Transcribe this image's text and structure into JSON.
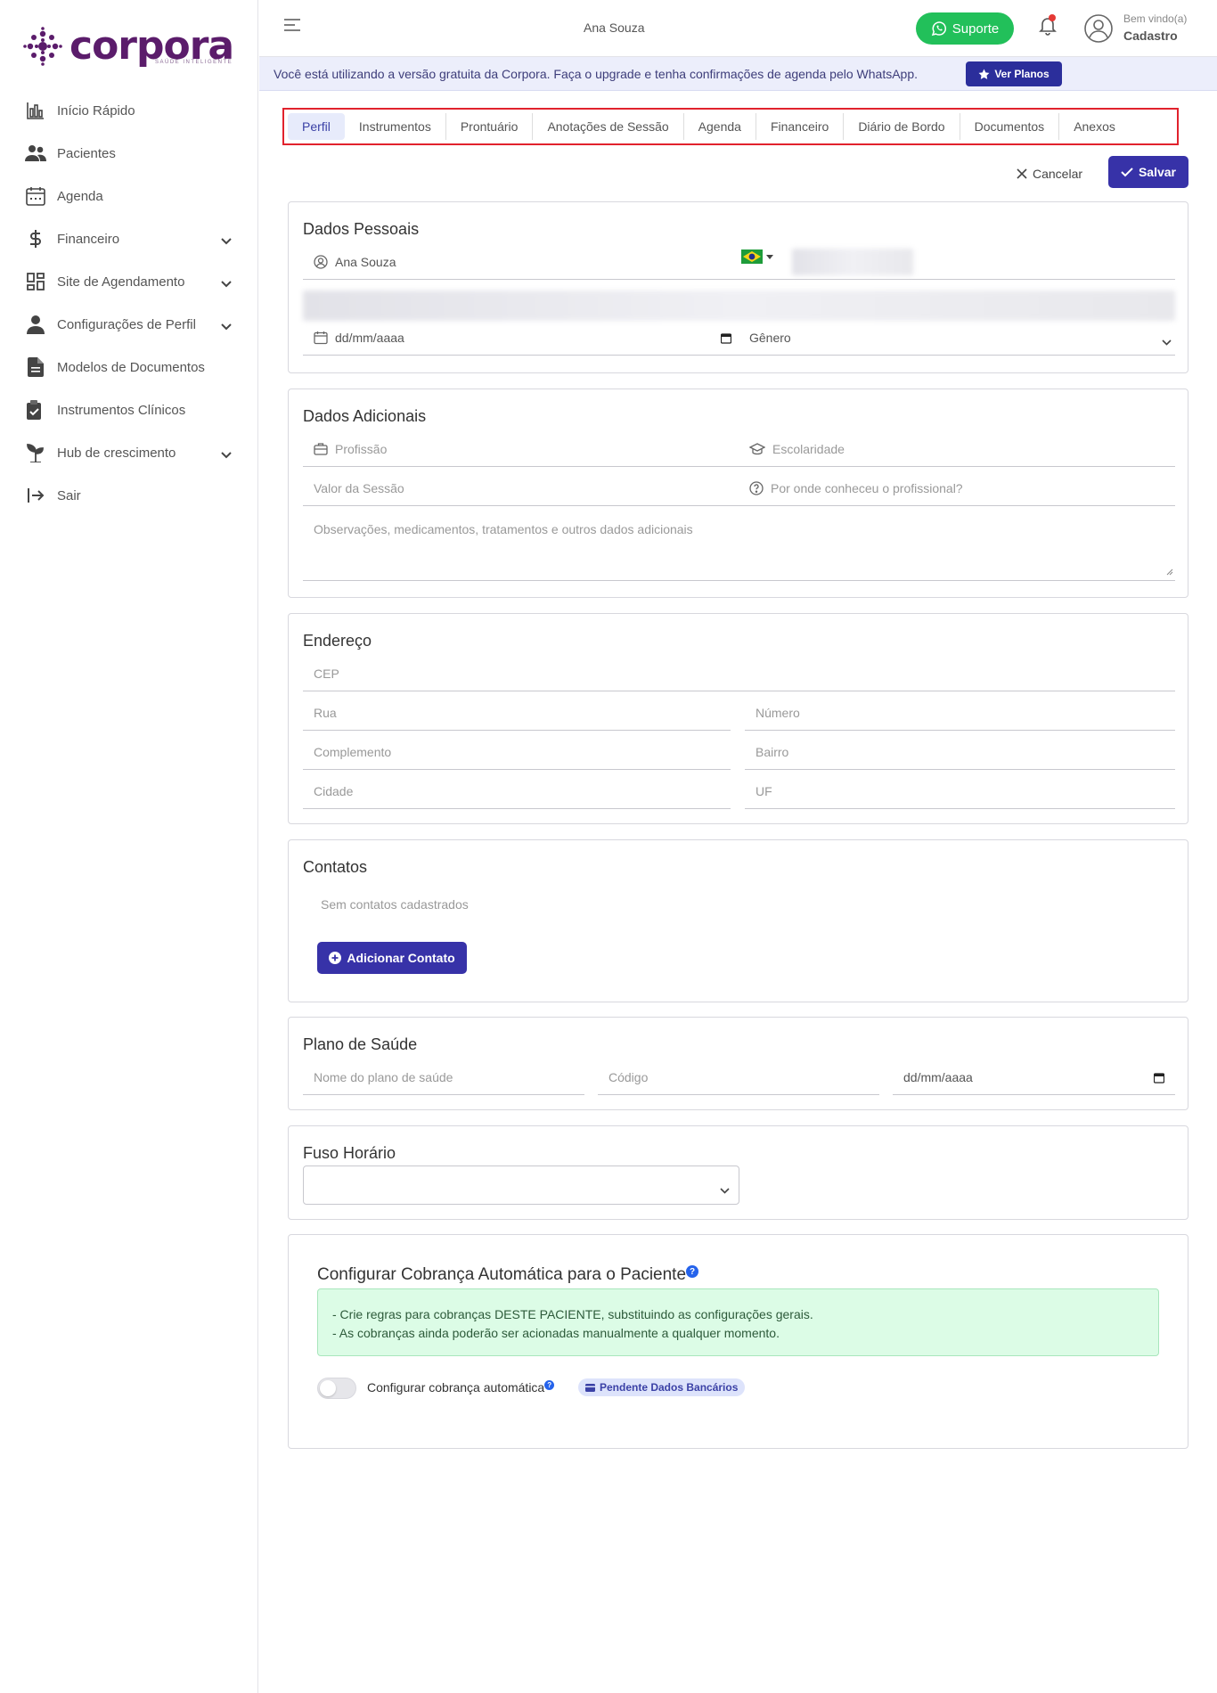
{
  "brand": {
    "name": "corpora",
    "tagline": "SAÚDE INTELIGENTE"
  },
  "sidebar": {
    "items": [
      {
        "label": "Início Rápido",
        "icon": "chart-bar-icon"
      },
      {
        "label": "Pacientes",
        "icon": "users-icon"
      },
      {
        "label": "Agenda",
        "icon": "calendar-icon"
      },
      {
        "label": "Financeiro",
        "icon": "dollar-icon",
        "expandable": true
      },
      {
        "label": "Site de Agendamento",
        "icon": "dashboard-icon",
        "expandable": true
      },
      {
        "label": "Configurações de Perfil",
        "icon": "user-icon",
        "expandable": true
      },
      {
        "label": "Modelos de Documentos",
        "icon": "document-icon"
      },
      {
        "label": "Instrumentos Clínicos",
        "icon": "clipboard-check-icon"
      },
      {
        "label": "Hub de crescimento",
        "icon": "sprout-icon",
        "expandable": true
      },
      {
        "label": "Sair",
        "icon": "logout-icon"
      }
    ]
  },
  "header": {
    "patient_name": "Ana Souza",
    "support_label": "Suporte",
    "welcome": "Bem vindo(a)",
    "user_name": "Cadastro"
  },
  "banner": {
    "text": "Você está utilizando a versão gratuita da Corpora. Faça o upgrade e tenha confirmações de agenda pelo WhatsApp.",
    "button": "Ver Planos"
  },
  "tabs": [
    "Perfil",
    "Instrumentos",
    "Prontuário",
    "Anotações de Sessão",
    "Agenda",
    "Financeiro",
    "Diário de Bordo",
    "Documentos",
    "Anexos"
  ],
  "active_tab": "Perfil",
  "actions": {
    "cancel": "Cancelar",
    "save": "Salvar"
  },
  "personal": {
    "title": "Dados Pessoais",
    "name": "Ana Souza",
    "birth_placeholder": "dd/mm/aaaa",
    "gender_placeholder": "Gênero"
  },
  "additional": {
    "title": "Dados Adicionais",
    "profession": "Profissão",
    "education": "Escolaridade",
    "session_value": "Valor da Sessão",
    "referral": "Por onde conheceu o profissional?",
    "notes": "Observações, medicamentos, tratamentos e outros dados adicionais"
  },
  "address": {
    "title": "Endereço",
    "cep": "CEP",
    "street": "Rua",
    "number": "Número",
    "complement": "Complemento",
    "district": "Bairro",
    "city": "Cidade",
    "state": "UF"
  },
  "contacts": {
    "title": "Contatos",
    "empty": "Sem contatos cadastrados",
    "add": "Adicionar Contato"
  },
  "health_plan": {
    "title": "Plano de Saúde",
    "name": "Nome do plano de saúde",
    "code": "Código",
    "date": "dd/mm/aaaa"
  },
  "timezone": {
    "title": "Fuso Horário"
  },
  "billing": {
    "title": "Configurar Cobrança Automática para o Paciente",
    "line1": "- Crie regras para cobranças DESTE PACIENTE, substituindo as configurações gerais.",
    "line2": "- As cobranças ainda poderão ser acionadas manualmente a qualquer momento.",
    "toggle_label": "Configurar cobrança automática",
    "badge": "Pendente Dados Bancários"
  },
  "colors": {
    "primary": "#3732a8",
    "brand": "#5b1c6b",
    "support": "#22c05a",
    "alert": "#dcfce6"
  }
}
